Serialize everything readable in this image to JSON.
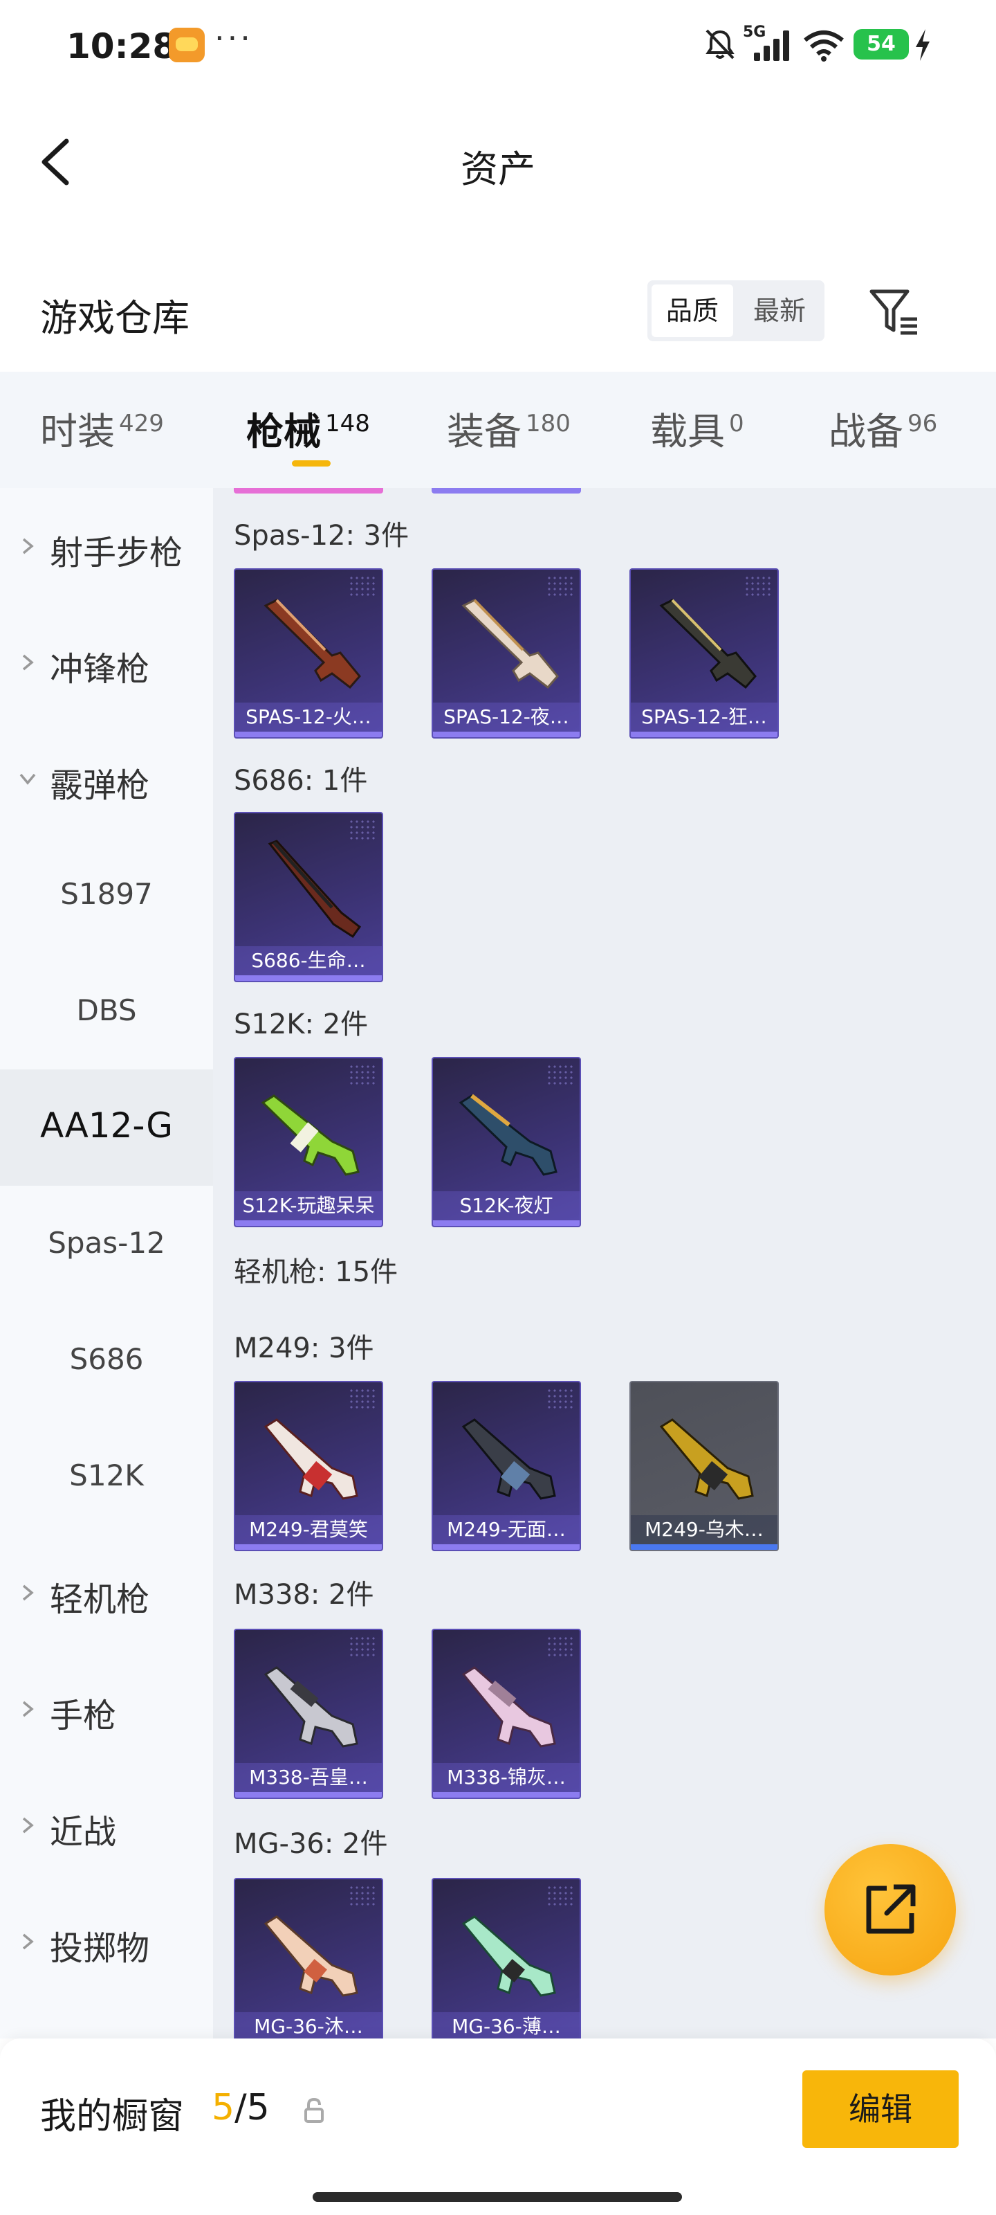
{
  "status_bar": {
    "time": "10:28",
    "dots": "···",
    "network": "5G",
    "battery": "54",
    "icons": [
      "app-badge-icon",
      "bell-muted-icon",
      "signal-icon",
      "wifi-icon",
      "battery-icon",
      "charging-icon"
    ]
  },
  "header": {
    "title": "资产",
    "back_icon": "chevron-left-icon"
  },
  "warehouse": {
    "title": "游戏仓库",
    "sort_options": [
      "品质",
      "最新"
    ],
    "sort_selected": "品质",
    "filter_icon": "filter-icon"
  },
  "tabs": [
    {
      "label": "时装",
      "count": "429"
    },
    {
      "label": "枪械",
      "count": "148"
    },
    {
      "label": "装备",
      "count": "180"
    },
    {
      "label": "载具",
      "count": "0"
    },
    {
      "label": "战备",
      "count": "96"
    }
  ],
  "active_tab": "枪械",
  "accent_color": "#f5b60c",
  "sidebar": {
    "items": [
      {
        "label": "射手步枪",
        "type": "parent",
        "expanded": false
      },
      {
        "label": "冲锋枪",
        "type": "parent",
        "expanded": false
      },
      {
        "label": "霰弹枪",
        "type": "parent",
        "expanded": true
      },
      {
        "label": "S1897",
        "type": "child"
      },
      {
        "label": "DBS",
        "type": "child"
      },
      {
        "label": "AA12-G",
        "type": "child",
        "selected": true
      },
      {
        "label": "Spas-12",
        "type": "child"
      },
      {
        "label": "S686",
        "type": "child"
      },
      {
        "label": "S12K",
        "type": "child"
      },
      {
        "label": "轻机枪",
        "type": "parent",
        "expanded": false
      },
      {
        "label": "手枪",
        "type": "parent",
        "expanded": false
      },
      {
        "label": "近战",
        "type": "parent",
        "expanded": false
      },
      {
        "label": "投掷物",
        "type": "parent",
        "expanded": false
      }
    ]
  },
  "content": {
    "groups": [
      {
        "label": "Spas-12: 3件",
        "items": [
          "SPAS-12-火…",
          "SPAS-12-夜…",
          "SPAS-12-狂…"
        ]
      },
      {
        "label": "S686: 1件",
        "items": [
          "S686-生命…"
        ]
      },
      {
        "label": "S12K: 2件",
        "items": [
          "S12K-玩趣呆呆",
          "S12K-夜灯"
        ]
      },
      {
        "label": "轻机枪: 15件",
        "items": []
      },
      {
        "label": "M249: 3件",
        "items": [
          "M249-君莫笑",
          "M249-无面…",
          "M249-乌木…"
        ]
      },
      {
        "label": "M338: 2件",
        "items": [
          "M338-吾皇…",
          "M338-锦灰…"
        ]
      },
      {
        "label": "MG-36: 2件",
        "items": [
          "MG-36-沐…",
          "MG-36-薄…"
        ]
      }
    ]
  },
  "fab_icon": "share-external-icon",
  "bottom": {
    "title": "我的橱窗",
    "count_current": "5",
    "count_sep": "/",
    "count_total": "5",
    "lock_icon": "lock-icon",
    "edit_label": "编辑"
  }
}
